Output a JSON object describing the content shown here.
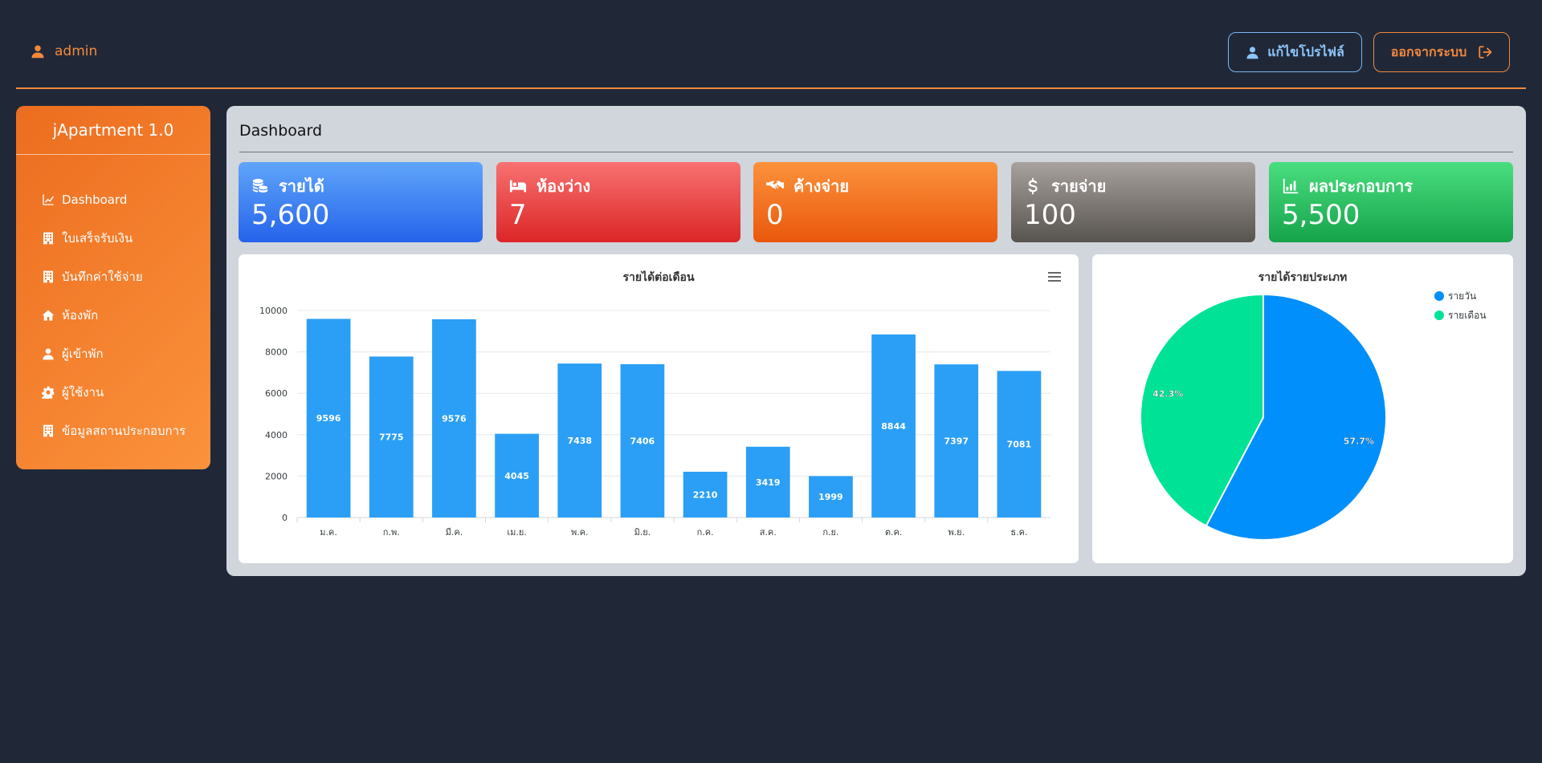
{
  "header": {
    "username": "admin",
    "edit_profile_label": "แก้ไขโปรไฟล์",
    "logout_label": "ออกจากระบบ"
  },
  "sidebar": {
    "brand": "jApartment 1.0",
    "items": [
      {
        "label": "Dashboard",
        "icon": "chart-line-icon"
      },
      {
        "label": "ใบเสร็จรับเงิน",
        "icon": "building-icon"
      },
      {
        "label": "บันทึกค่าใช้จ่าย",
        "icon": "building-icon"
      },
      {
        "label": "ห้องพัก",
        "icon": "home-icon"
      },
      {
        "label": "ผู้เข้าพัก",
        "icon": "user-icon"
      },
      {
        "label": "ผู้ใช้งาน",
        "icon": "gear-icon"
      },
      {
        "label": "ข้อมูลสถานประกอบการ",
        "icon": "building-icon"
      }
    ]
  },
  "main": {
    "title": "Dashboard",
    "cards": [
      {
        "label": "รายได้",
        "value": "5,600",
        "icon": "coins-icon",
        "color": "#3b82f6"
      },
      {
        "label": "ห้องว่าง",
        "value": "7",
        "icon": "bed-icon",
        "color": "#ef4444"
      },
      {
        "label": "ค้างจ่าย",
        "value": "0",
        "icon": "handshake-icon",
        "color": "#f97316"
      },
      {
        "label": "รายจ่าย",
        "value": "100",
        "icon": "dollar-icon",
        "color": "#78716c"
      },
      {
        "label": "ผลประกอบการ",
        "value": "5,500",
        "icon": "chart-bar-icon",
        "color": "#22c55e"
      }
    ]
  },
  "chart_data": [
    {
      "type": "bar",
      "title": "รายได้ต่อเดือน",
      "categories": [
        "ม.ค.",
        "ก.พ.",
        "มี.ค.",
        "เม.ย.",
        "พ.ค.",
        "มิ.ย.",
        "ก.ค.",
        "ส.ค.",
        "ก.ย.",
        "ต.ค.",
        "พ.ย.",
        "ธ.ค."
      ],
      "values": [
        9596,
        7775,
        9576,
        4045,
        7438,
        7406,
        2210,
        3419,
        1999,
        8844,
        7397,
        7081
      ],
      "yticks": [
        "0",
        "2000",
        "4000",
        "6000",
        "8000",
        "10000"
      ],
      "ylim": [
        0,
        10000
      ],
      "grid": true,
      "color": "#2b9ff5"
    },
    {
      "type": "pie",
      "title": "รายได้รายประเภท",
      "labels": [
        "รายวัน",
        "รายเดือน"
      ],
      "values": [
        57.7,
        42.3
      ],
      "value_labels": [
        "57.7%",
        "42.3%"
      ],
      "colors": [
        "#008ffb",
        "#00e396"
      ],
      "legend_position": "top-right"
    }
  ]
}
